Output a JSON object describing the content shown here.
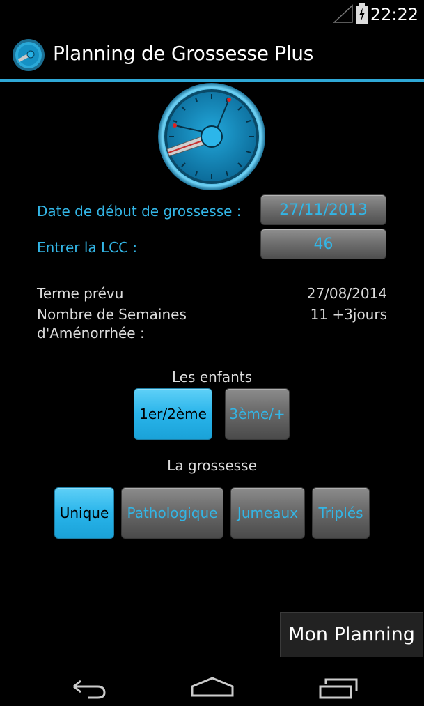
{
  "status_bar": {
    "time": "22:22"
  },
  "app": {
    "title": "Planning de Grossesse Plus"
  },
  "form": {
    "date_label": "Date de début de grossesse :",
    "date_value": "27/11/2013",
    "lcc_label": "Entrer la LCC :",
    "lcc_value": "46"
  },
  "results": {
    "term_label": "Terme prévu",
    "term_value": "27/08/2014",
    "weeks_label_line1": "Nombre de Semaines",
    "weeks_label_line2": "d'Aménorrhée :",
    "weeks_value": "11 +3jours"
  },
  "children": {
    "title": "Les enfants",
    "options": [
      "1er/2ème",
      "3ème/+"
    ],
    "selected": "1er/2ème"
  },
  "pregnancy": {
    "title": "La grossesse",
    "options": [
      "Unique",
      "Pathologique",
      "Jumeaux",
      "Triplés"
    ],
    "selected": "Unique"
  },
  "actions": {
    "mon_planning": "Mon Planning"
  },
  "icons": {
    "signal": "signal-icon",
    "battery": "battery-icon",
    "logo": "dial-logo-icon",
    "back": "back-icon",
    "home": "home-icon",
    "recents": "recents-icon"
  },
  "colors": {
    "accent": "#33b5e5",
    "selected": "#29b4ea",
    "background": "#000000"
  }
}
